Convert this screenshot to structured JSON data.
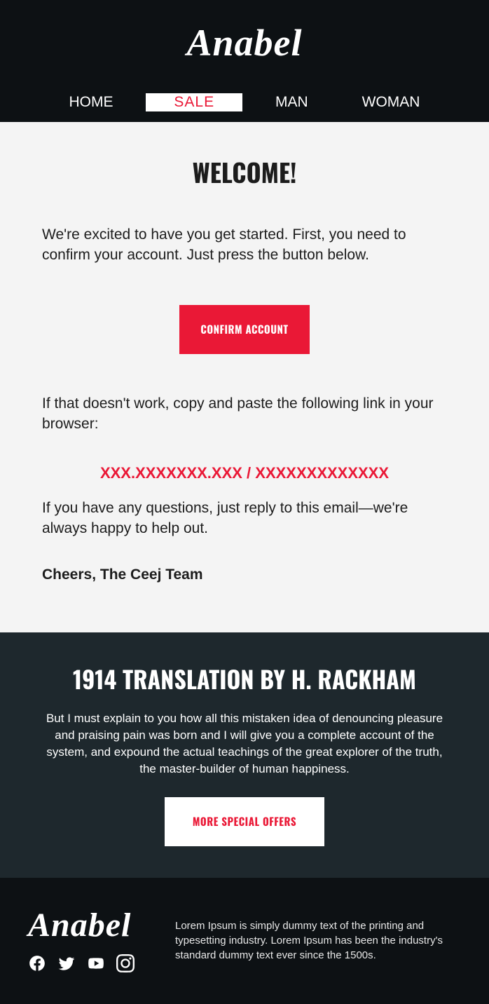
{
  "brand": "Anabel",
  "nav": {
    "items": [
      "HOME",
      "SALE",
      "MAN",
      "WOMAN"
    ],
    "active_index": 1
  },
  "main": {
    "title": "WELCOME!",
    "intro": "We're excited to have you get started. First, you need to confirm your account. Just press the button below.",
    "confirm_button": "CONFIRM ACCOUNT",
    "fallback_intro": "If that doesn't work, copy and paste the following link in your browser:",
    "fallback_link": "XXX.XXXXXXX.XXX / XXXXXXXXXXXXX",
    "help_text": "If you have any questions, just reply to this email—we're always happy to help out.",
    "signoff": "Cheers, The Ceej Team"
  },
  "promo": {
    "title": "1914 TRANSLATION BY H. RACKHAM",
    "body": "But I must explain to you how all this mistaken idea of denouncing pleasure and praising pain was born and I will give you a complete account of the system, and expound the actual teachings of the great explorer of the truth, the master-builder of human happiness.",
    "button": "MORE SPECIAL OFFERS"
  },
  "footer": {
    "about": "Lorem Ipsum is simply dummy text of the printing and typesetting industry. Lorem Ipsum has been the industry's standard dummy text ever since the 1500s."
  }
}
